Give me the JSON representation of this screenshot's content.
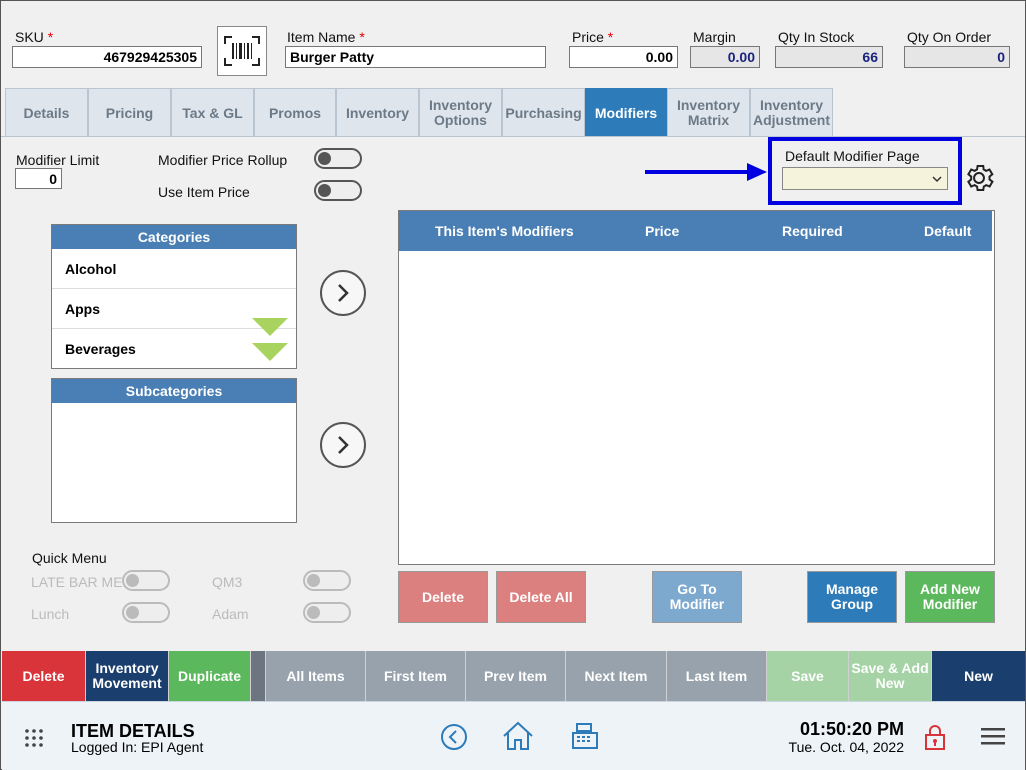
{
  "header": {
    "sku_label": "SKU",
    "sku_value": "467929425305",
    "item_name_label": "Item Name",
    "item_name_value": "Burger Patty",
    "price_label": "Price",
    "price_value": "0.00",
    "margin_label": "Margin",
    "margin_value": "0.00",
    "qty_in_stock_label": "Qty In Stock",
    "qty_in_stock_value": "66",
    "qty_on_order_label": "Qty On Order",
    "qty_on_order_value": "0",
    "required_mark": "*"
  },
  "tabs": [
    {
      "label": "Details"
    },
    {
      "label": "Pricing"
    },
    {
      "label": "Tax & GL"
    },
    {
      "label": "Promos"
    },
    {
      "label": "Inventory"
    },
    {
      "label": "Inventory Options"
    },
    {
      "label": "Purchasing"
    },
    {
      "label": "Modifiers"
    },
    {
      "label": "Inventory Matrix"
    },
    {
      "label": "Inventory Adjustment"
    }
  ],
  "active_tab": "Modifiers",
  "modifiers": {
    "limit_label": "Modifier Limit",
    "limit_value": "0",
    "price_rollup_label": "Modifier Price Rollup",
    "use_item_price_label": "Use Item Price",
    "default_page_label": "Default Modifier Page",
    "default_page_value": "",
    "categories_header": "Categories",
    "categories": [
      "Alcohol",
      "Apps",
      "Beverages"
    ],
    "subcategories_header": "Subcategories",
    "grid_columns": [
      "This Item's Modifiers",
      "Price",
      "Required",
      "Default"
    ],
    "quick_menu_label": "Quick Menu",
    "quick_menu_items": [
      "LATE BAR MENU",
      "QM3",
      "Lunch",
      "Adam"
    ],
    "buttons": {
      "delete": "Delete",
      "delete_all": "Delete All",
      "go_to_modifier": "Go To Modifier",
      "manage_group": "Manage Group",
      "add_new_modifier": "Add New Modifier"
    }
  },
  "action_bar": [
    {
      "label": "Delete",
      "color": "#d9343a"
    },
    {
      "label": "Inventory Movement",
      "color": "#1a3f6e"
    },
    {
      "label": "Duplicate",
      "color": "#5cb85c"
    },
    {
      "label": "",
      "color": "#6d7680"
    },
    {
      "label": "All Items",
      "color": "#97a2ad"
    },
    {
      "label": "First Item",
      "color": "#97a2ad"
    },
    {
      "label": "Prev Item",
      "color": "#97a2ad"
    },
    {
      "label": "Next Item",
      "color": "#97a2ad"
    },
    {
      "label": "Last Item",
      "color": "#97a2ad"
    },
    {
      "label": "Save",
      "color": "#a5d3a5"
    },
    {
      "label": "Save & Add New",
      "color": "#a5d3a5"
    },
    {
      "label": "New",
      "color": "#1a3f6e"
    }
  ],
  "footer": {
    "screen_title": "ITEM DETAILS",
    "logged_in": "Logged In:  EPI Agent",
    "time": "01:50:20 PM",
    "date": "Tue. Oct. 04, 2022"
  },
  "colors": {
    "accent": "#2d7bb8",
    "highlight_box": "#0000e0",
    "arrow": "#0000e0"
  }
}
